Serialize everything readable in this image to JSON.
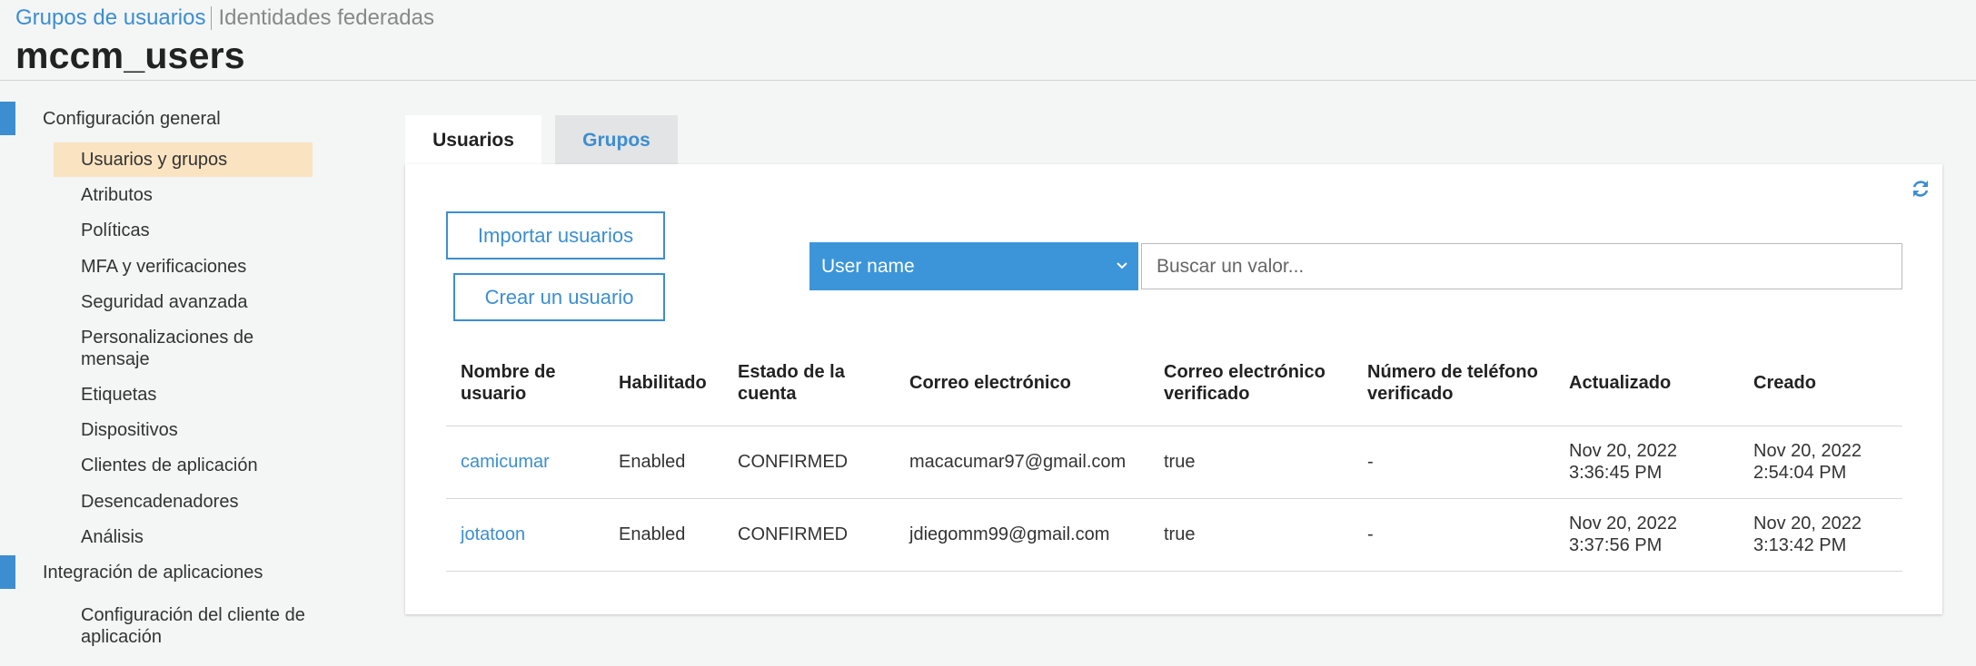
{
  "breadcrumb": {
    "link": "Grupos de usuarios",
    "current": "Identidades federadas"
  },
  "page_title": "mccm_users",
  "sidebar": {
    "sections": [
      {
        "label": "Configuración general"
      },
      {
        "label": "Integración de aplicaciones"
      }
    ],
    "general_items": [
      {
        "label": "Usuarios y grupos"
      },
      {
        "label": "Atributos"
      },
      {
        "label": "Políticas"
      },
      {
        "label": "MFA y verificaciones"
      },
      {
        "label": "Seguridad avanzada"
      },
      {
        "label": "Personalizaciones de mensaje"
      },
      {
        "label": "Etiquetas"
      },
      {
        "label": "Dispositivos"
      },
      {
        "label": "Clientes de aplicación"
      },
      {
        "label": "Desencadenadores"
      },
      {
        "label": "Análisis"
      }
    ],
    "integration_items": [
      {
        "label": "Configuración del cliente de aplicación"
      }
    ]
  },
  "tabs": [
    {
      "label": "Usuarios"
    },
    {
      "label": "Grupos"
    }
  ],
  "toolbar": {
    "import_label": "Importar usuarios",
    "create_label": "Crear un usuario",
    "filter_selected": "User name",
    "search_placeholder": "Buscar un valor..."
  },
  "table": {
    "headers": [
      "Nombre de usuario",
      "Habilitado",
      "Estado de la cuenta",
      "Correo electrónico",
      "Correo electrónico verificado",
      "Número de teléfono verificado",
      "Actualizado",
      "Creado"
    ],
    "rows": [
      {
        "username": "camicumar",
        "enabled": "Enabled",
        "status": "CONFIRMED",
        "email": "macacumar97@gmail.com",
        "email_verified": "true",
        "phone_verified": "-",
        "updated": "Nov 20, 2022 3:36:45 PM",
        "created": "Nov 20, 2022 2:54:04 PM"
      },
      {
        "username": "jotatoon",
        "enabled": "Enabled",
        "status": "CONFIRMED",
        "email": "jdiegomm99@gmail.com",
        "email_verified": "true",
        "phone_verified": "-",
        "updated": "Nov 20, 2022 3:37:56 PM",
        "created": "Nov 20, 2022 3:13:42 PM"
      }
    ]
  },
  "colors": {
    "accent": "#3c8ed0",
    "active_nav": "#f9e3c1",
    "select_bg": "#3c95d9"
  },
  "icons": {
    "refresh": "refresh-icon",
    "dropdown": "chevron-down-icon"
  }
}
